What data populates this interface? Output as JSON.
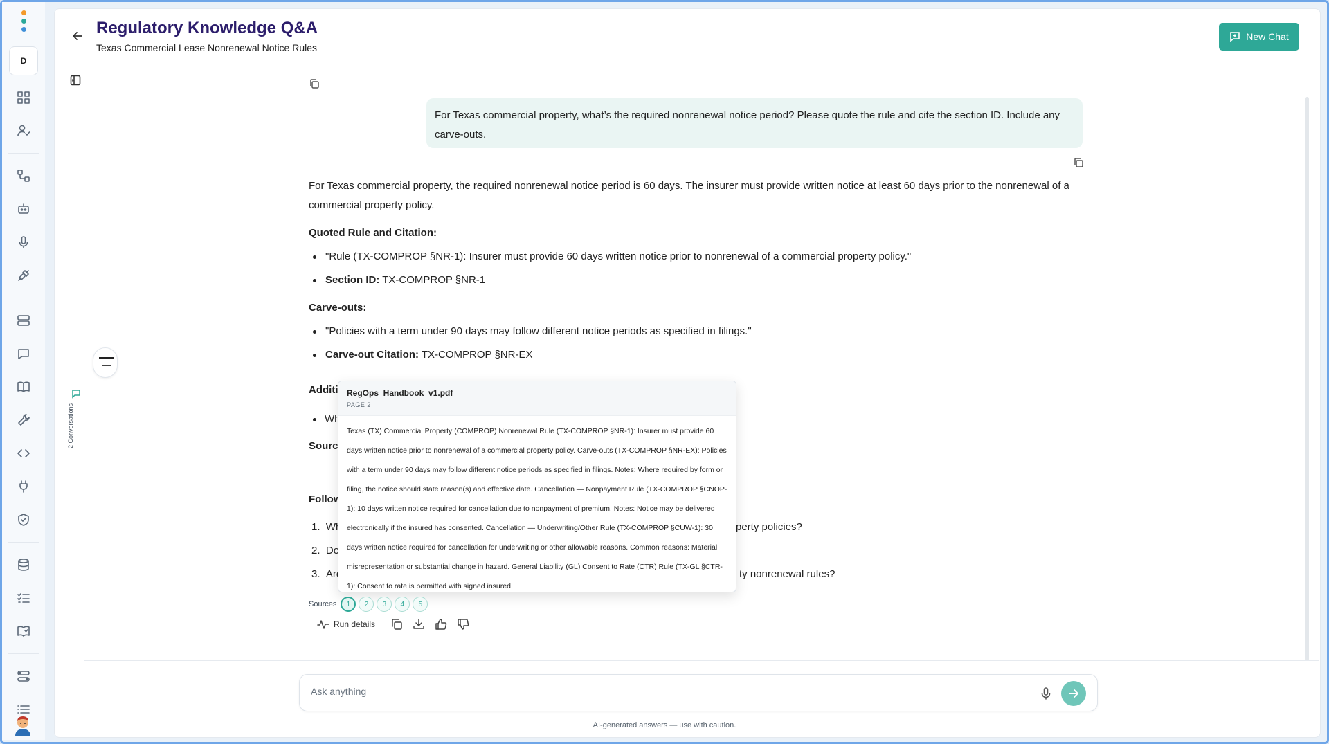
{
  "rail": {
    "workspace_initial": "D",
    "icons": [
      "dashboard-icon",
      "user-check-icon",
      "workflow-icon",
      "bot-icon",
      "microphone-icon",
      "integration-icon",
      "storage-icon",
      "chat-icon",
      "book-icon",
      "wrench-icon",
      "code-icon",
      "plug-icon",
      "shield-icon",
      "database-icon",
      "checklist-icon",
      "knowledge-icon",
      "routes-icon",
      "list-icon"
    ]
  },
  "header": {
    "title": "Regulatory Knowledge Q&A",
    "subtitle": "Texas Commercial Lease Nonrenewal Notice Rules",
    "new_chat_label": "New Chat"
  },
  "sidebar": {
    "conversations_label": "2 Conversations"
  },
  "chat": {
    "user_message": "For Texas commercial property, what’s the required nonrenewal notice period? Please quote the rule and cite the section ID. Include any carve-outs.",
    "answer_intro": "For Texas commercial property, the required nonrenewal notice period is 60 days. The insurer must provide written notice at least 60 days prior to the nonrenewal of a commercial property policy.",
    "quoted_heading": "Quoted Rule and Citation:",
    "quoted_items": [
      {
        "label": "",
        "text": "\"Rule (TX-COMPROP §NR-1): Insurer must provide 60 days written notice prior to nonrenewal of a commercial property policy.\""
      },
      {
        "label": "Section ID:",
        "text": " TX-COMPROP §NR-1"
      }
    ],
    "carve_heading": "Carve-outs:",
    "carve_items": [
      {
        "label": "",
        "text": "\"Policies with a term under 90 days may follow different notice periods as specified in filings.\""
      },
      {
        "label": "Carve-out Citation:",
        "text": " TX-COMPROP §NR-EX"
      }
    ],
    "partial_additional": "Additi",
    "partial_wh": "Wh",
    "partial_sources": "Source",
    "partial_followup": "Follow",
    "followups": [
      {
        "num": "1.",
        "start": "Wh",
        "end": "perty policies?"
      },
      {
        "num": "2.",
        "start": "Do",
        "end": ""
      },
      {
        "num": "3.",
        "start": "Are",
        "end": "ty nonrenewal rules?"
      }
    ],
    "sources_label": "Sources",
    "sources": [
      "1",
      "2",
      "3",
      "4",
      "5"
    ],
    "run_details_label": "Run details"
  },
  "popover": {
    "filename": "RegOps_Handbook_v1.pdf",
    "page": "PAGE 2",
    "body": "Texas (TX) Commercial Property (COMPROP) Nonrenewal Rule (TX-COMPROP §NR-1): Insurer must provide 60 days written notice prior to nonrenewal of a commercial property policy. Carve-outs (TX-COMPROP §NR-EX): Policies with a term under 90 days may follow different notice periods as specified in filings. Notes: Where required by form or filing, the notice should state reason(s) and effective date. Cancellation — Nonpayment Rule (TX-COMPROP §CNOP-1): 10 days written notice required for cancellation due to nonpayment of premium. Notes: Notice may be delivered electronically if the insured has consented. Cancellation — Underwriting/Other Rule (TX-COMPROP §CUW-1): 30 days written notice required for cancellation for underwriting or other allowable reasons. Common reasons: Material misrepresentation or substantial change in hazard. General Liability (GL) Consent to Rate (CTR) Rule (TX-GL §CTR-1): Consent to rate is permitted with signed insured"
  },
  "composer": {
    "placeholder": "Ask anything",
    "disclaimer": "AI-generated answers — use with caution."
  },
  "colors": {
    "accent": "#2ea897",
    "title": "#2c1d6b"
  }
}
